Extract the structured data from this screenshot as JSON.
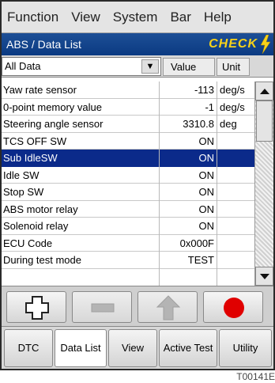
{
  "menu": {
    "items": [
      "Function",
      "View",
      "System",
      "Bar",
      "Help"
    ]
  },
  "titlebar": {
    "title": "ABS / Data List",
    "status": "CHECK"
  },
  "header": {
    "category": "All Data",
    "value_col": "Value",
    "unit_col": "Unit"
  },
  "rows": [
    {
      "name": "Yaw rate sensor",
      "value": "-113",
      "unit": "deg/s"
    },
    {
      "name": "0-point memory value",
      "value": "-1",
      "unit": "deg/s"
    },
    {
      "name": "Steering angle sensor",
      "value": "3310.8",
      "unit": "deg"
    },
    {
      "name": "TCS OFF SW",
      "value": "ON",
      "unit": ""
    },
    {
      "name": "Sub IdleSW",
      "value": "ON",
      "unit": ""
    },
    {
      "name": "Idle SW",
      "value": "ON",
      "unit": ""
    },
    {
      "name": "Stop SW",
      "value": "ON",
      "unit": ""
    },
    {
      "name": "ABS motor relay",
      "value": "ON",
      "unit": ""
    },
    {
      "name": "Solenoid relay",
      "value": "ON",
      "unit": ""
    },
    {
      "name": "ECU Code",
      "value": "0x000F",
      "unit": ""
    },
    {
      "name": "During test mode",
      "value": "TEST",
      "unit": ""
    }
  ],
  "selected_row": "Sub IdleSW",
  "tabs": {
    "dtc": "DTC",
    "data_list": "Data List",
    "view": "View",
    "active_test": "Active Test",
    "utility": "Utility"
  },
  "footer": {
    "code": "T00141E"
  },
  "colors": {
    "title_bar": "#0b3a82",
    "selection": "#0b2a8a",
    "check": "#f7d21a",
    "record": "#e00000"
  },
  "icons": [
    "dropdown-arrow-icon",
    "lightning-bolt-icon",
    "plus-icon",
    "minus-icon",
    "up-arrow-icon",
    "record-icon",
    "scroll-up-icon",
    "scroll-down-icon"
  ]
}
